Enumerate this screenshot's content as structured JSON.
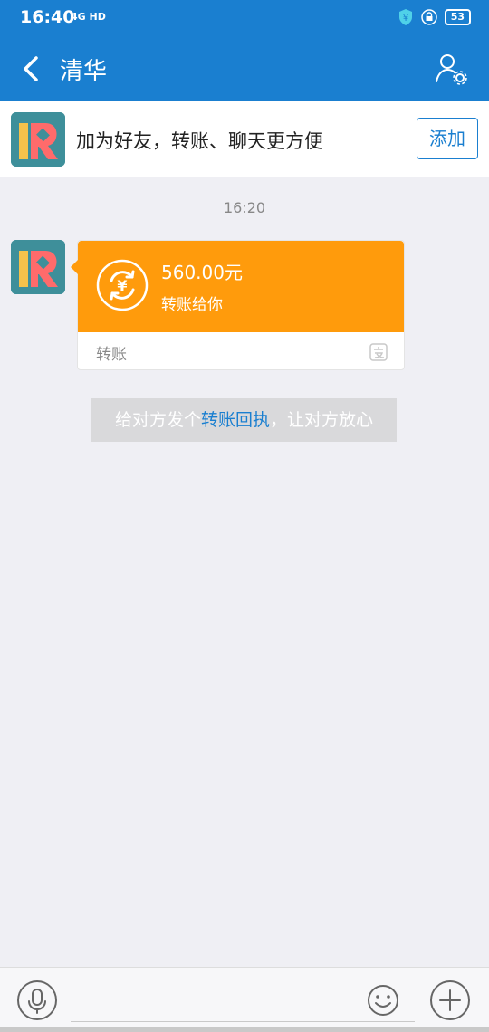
{
  "status_bar": {
    "time": "16:40",
    "network": "4G HD",
    "battery": "53"
  },
  "nav": {
    "title": "清华"
  },
  "add_friend": {
    "text": "加为好友，转账、聊天更方便",
    "button_label": "添加"
  },
  "chat": {
    "timestamp": "16:20",
    "transfer": {
      "amount": "560.00元",
      "description": "转账给你",
      "label": "转账"
    },
    "receipt_tip": {
      "before": "给对方发个",
      "link": "转账回执",
      "after": "，让对方放心"
    }
  },
  "input": {
    "placeholder": ""
  },
  "colors": {
    "brand": "#1a7fd0",
    "transfer_orange": "#ff9b0c",
    "background": "#efeff4"
  }
}
